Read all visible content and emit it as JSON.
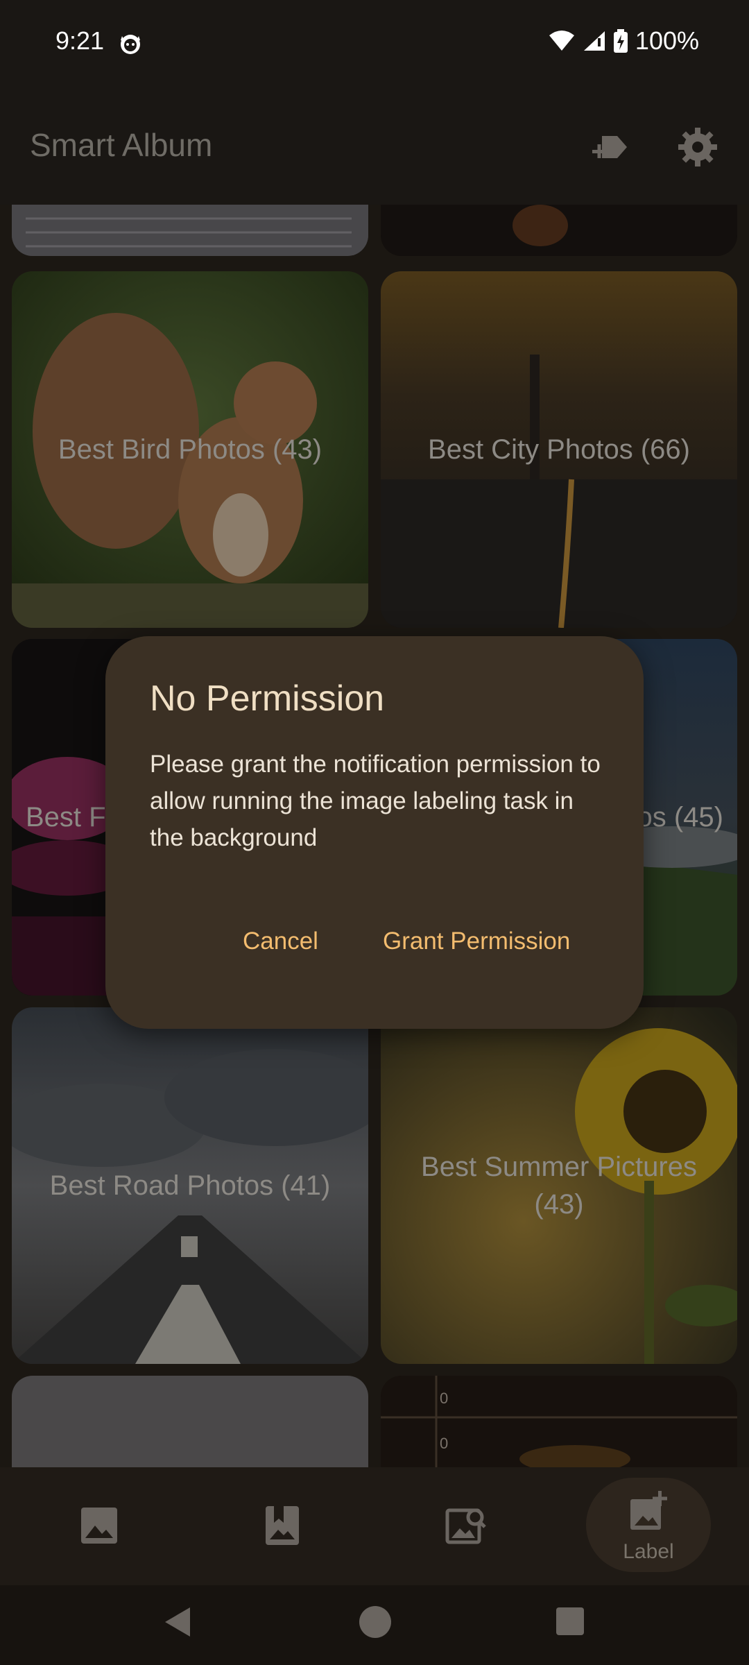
{
  "status_bar": {
    "time": "9:21",
    "battery": "100%"
  },
  "app_bar": {
    "title": "Smart Album"
  },
  "grid": {
    "tiles": [
      {
        "label": ""
      },
      {
        "label": ""
      },
      {
        "label": "Best Bird Photos (43)"
      },
      {
        "label": "Best City Photos (66)"
      },
      {
        "label": "Best F"
      },
      {
        "label": "os (45)"
      },
      {
        "label": "Best Road Photos (41)"
      },
      {
        "label": "Best Summer Pictures (43)"
      },
      {
        "label": ""
      },
      {
        "label": "0"
      },
      {
        "label": "0"
      }
    ]
  },
  "bottom_nav": {
    "items": [
      {
        "icon": "image-icon",
        "label": ""
      },
      {
        "icon": "bookmark-image-icon",
        "label": ""
      },
      {
        "icon": "image-search-icon",
        "label": ""
      },
      {
        "icon": "add-image-icon",
        "label": "Label"
      }
    ]
  },
  "dialog": {
    "title": "No Permission",
    "body": "Please grant the notification permission to allow running the image labeling task in the background",
    "cancel_label": "Cancel",
    "confirm_label": "Grant Permission"
  },
  "colors": {
    "accent": "#f3bc6f",
    "dialog_bg": "#3b3024",
    "dialog_title": "#f0dfc4"
  }
}
